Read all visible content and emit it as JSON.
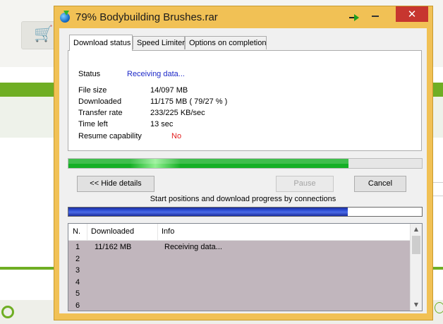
{
  "window": {
    "title": "79% Bodybuilding Brushes.rar",
    "close_glyph": "✕"
  },
  "tabs": [
    {
      "label": "Download status",
      "active": true
    },
    {
      "label": "Speed Limiter",
      "active": false
    },
    {
      "label": "Options on completion",
      "active": false
    }
  ],
  "status": {
    "status_label": "Status",
    "status_value": "Receiving data...",
    "file_size_label": "File size",
    "file_size_value": "14/097  MB",
    "downloaded_label": "Downloaded",
    "downloaded_value": "11/175  MB  ( 79/27 % )",
    "transfer_rate_label": "Transfer rate",
    "transfer_rate_value": "233/225  KB/sec",
    "time_left_label": "Time left",
    "time_left_value": "13 sec",
    "resume_label": "Resume capability",
    "resume_value": "No"
  },
  "progress": {
    "percent": 79.27
  },
  "buttons": {
    "hide_details": "<< Hide details",
    "pause": "Pause",
    "cancel": "Cancel"
  },
  "connections": {
    "caption": "Start positions and download progress by connections",
    "progress_fraction": 0.79,
    "columns": [
      "N.",
      "Downloaded",
      "Info"
    ],
    "rows": [
      {
        "n": "1",
        "downloaded": "11/162  MB",
        "info": "Receiving data..."
      },
      {
        "n": "2",
        "downloaded": "",
        "info": ""
      },
      {
        "n": "3",
        "downloaded": "",
        "info": ""
      },
      {
        "n": "4",
        "downloaded": "",
        "info": ""
      },
      {
        "n": "5",
        "downloaded": "",
        "info": ""
      },
      {
        "n": "6",
        "downloaded": "",
        "info": ""
      }
    ]
  },
  "colors": {
    "titlebar": "#f1c155",
    "close_button": "#c7362f",
    "progress_green": "#16b026",
    "connection_blue": "#3152d8",
    "status_blue": "#1c28c8",
    "resume_red": "#e21c1c",
    "list_row_bg": "#c1b6bd"
  },
  "icons": [
    "app-globe-icon",
    "pin-arrow-icon",
    "minimize-icon",
    "close-icon",
    "scroll-up-icon",
    "scroll-down-icon",
    "cart-icon",
    "lifebuoy-icon"
  ]
}
